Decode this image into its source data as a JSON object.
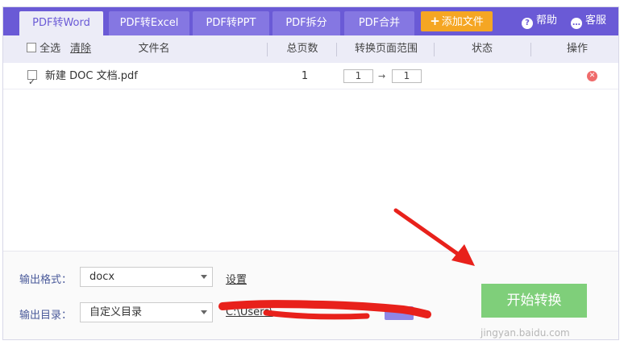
{
  "tabs": [
    {
      "label": "PDF转Word",
      "active": true
    },
    {
      "label": "PDF转Excel",
      "active": false
    },
    {
      "label": "PDF转PPT",
      "active": false
    },
    {
      "label": "PDF拆分",
      "active": false
    },
    {
      "label": "PDF合并",
      "active": false
    }
  ],
  "add_file_label": "添加文件",
  "help_label": "帮助",
  "service_label": "客服",
  "table": {
    "headers": {
      "select_all": "全选",
      "clear": "清除",
      "filename": "文件名",
      "total_pages": "总页数",
      "page_range": "转换页面范围",
      "status": "状态",
      "action": "操作"
    },
    "rows": [
      {
        "checked": true,
        "filename": "新建 DOC 文档.pdf",
        "total_pages": "1",
        "range_from": "1",
        "range_arrow": "→",
        "range_to": "1",
        "status": ""
      }
    ]
  },
  "output": {
    "format_label": "输出格式：",
    "format_value": "docx",
    "settings_link": "设置",
    "dir_label": "输出目录：",
    "dir_value": "自定义目录",
    "dir_path": "C:\\Users\\"
  },
  "start_button": "开始转换",
  "watermark": "jingyan.baidu.com",
  "colors": {
    "header": "#6a5ad6",
    "accent_orange": "#f5a623",
    "start_green": "#7fcf7a",
    "annotation_red": "#e8211b"
  }
}
